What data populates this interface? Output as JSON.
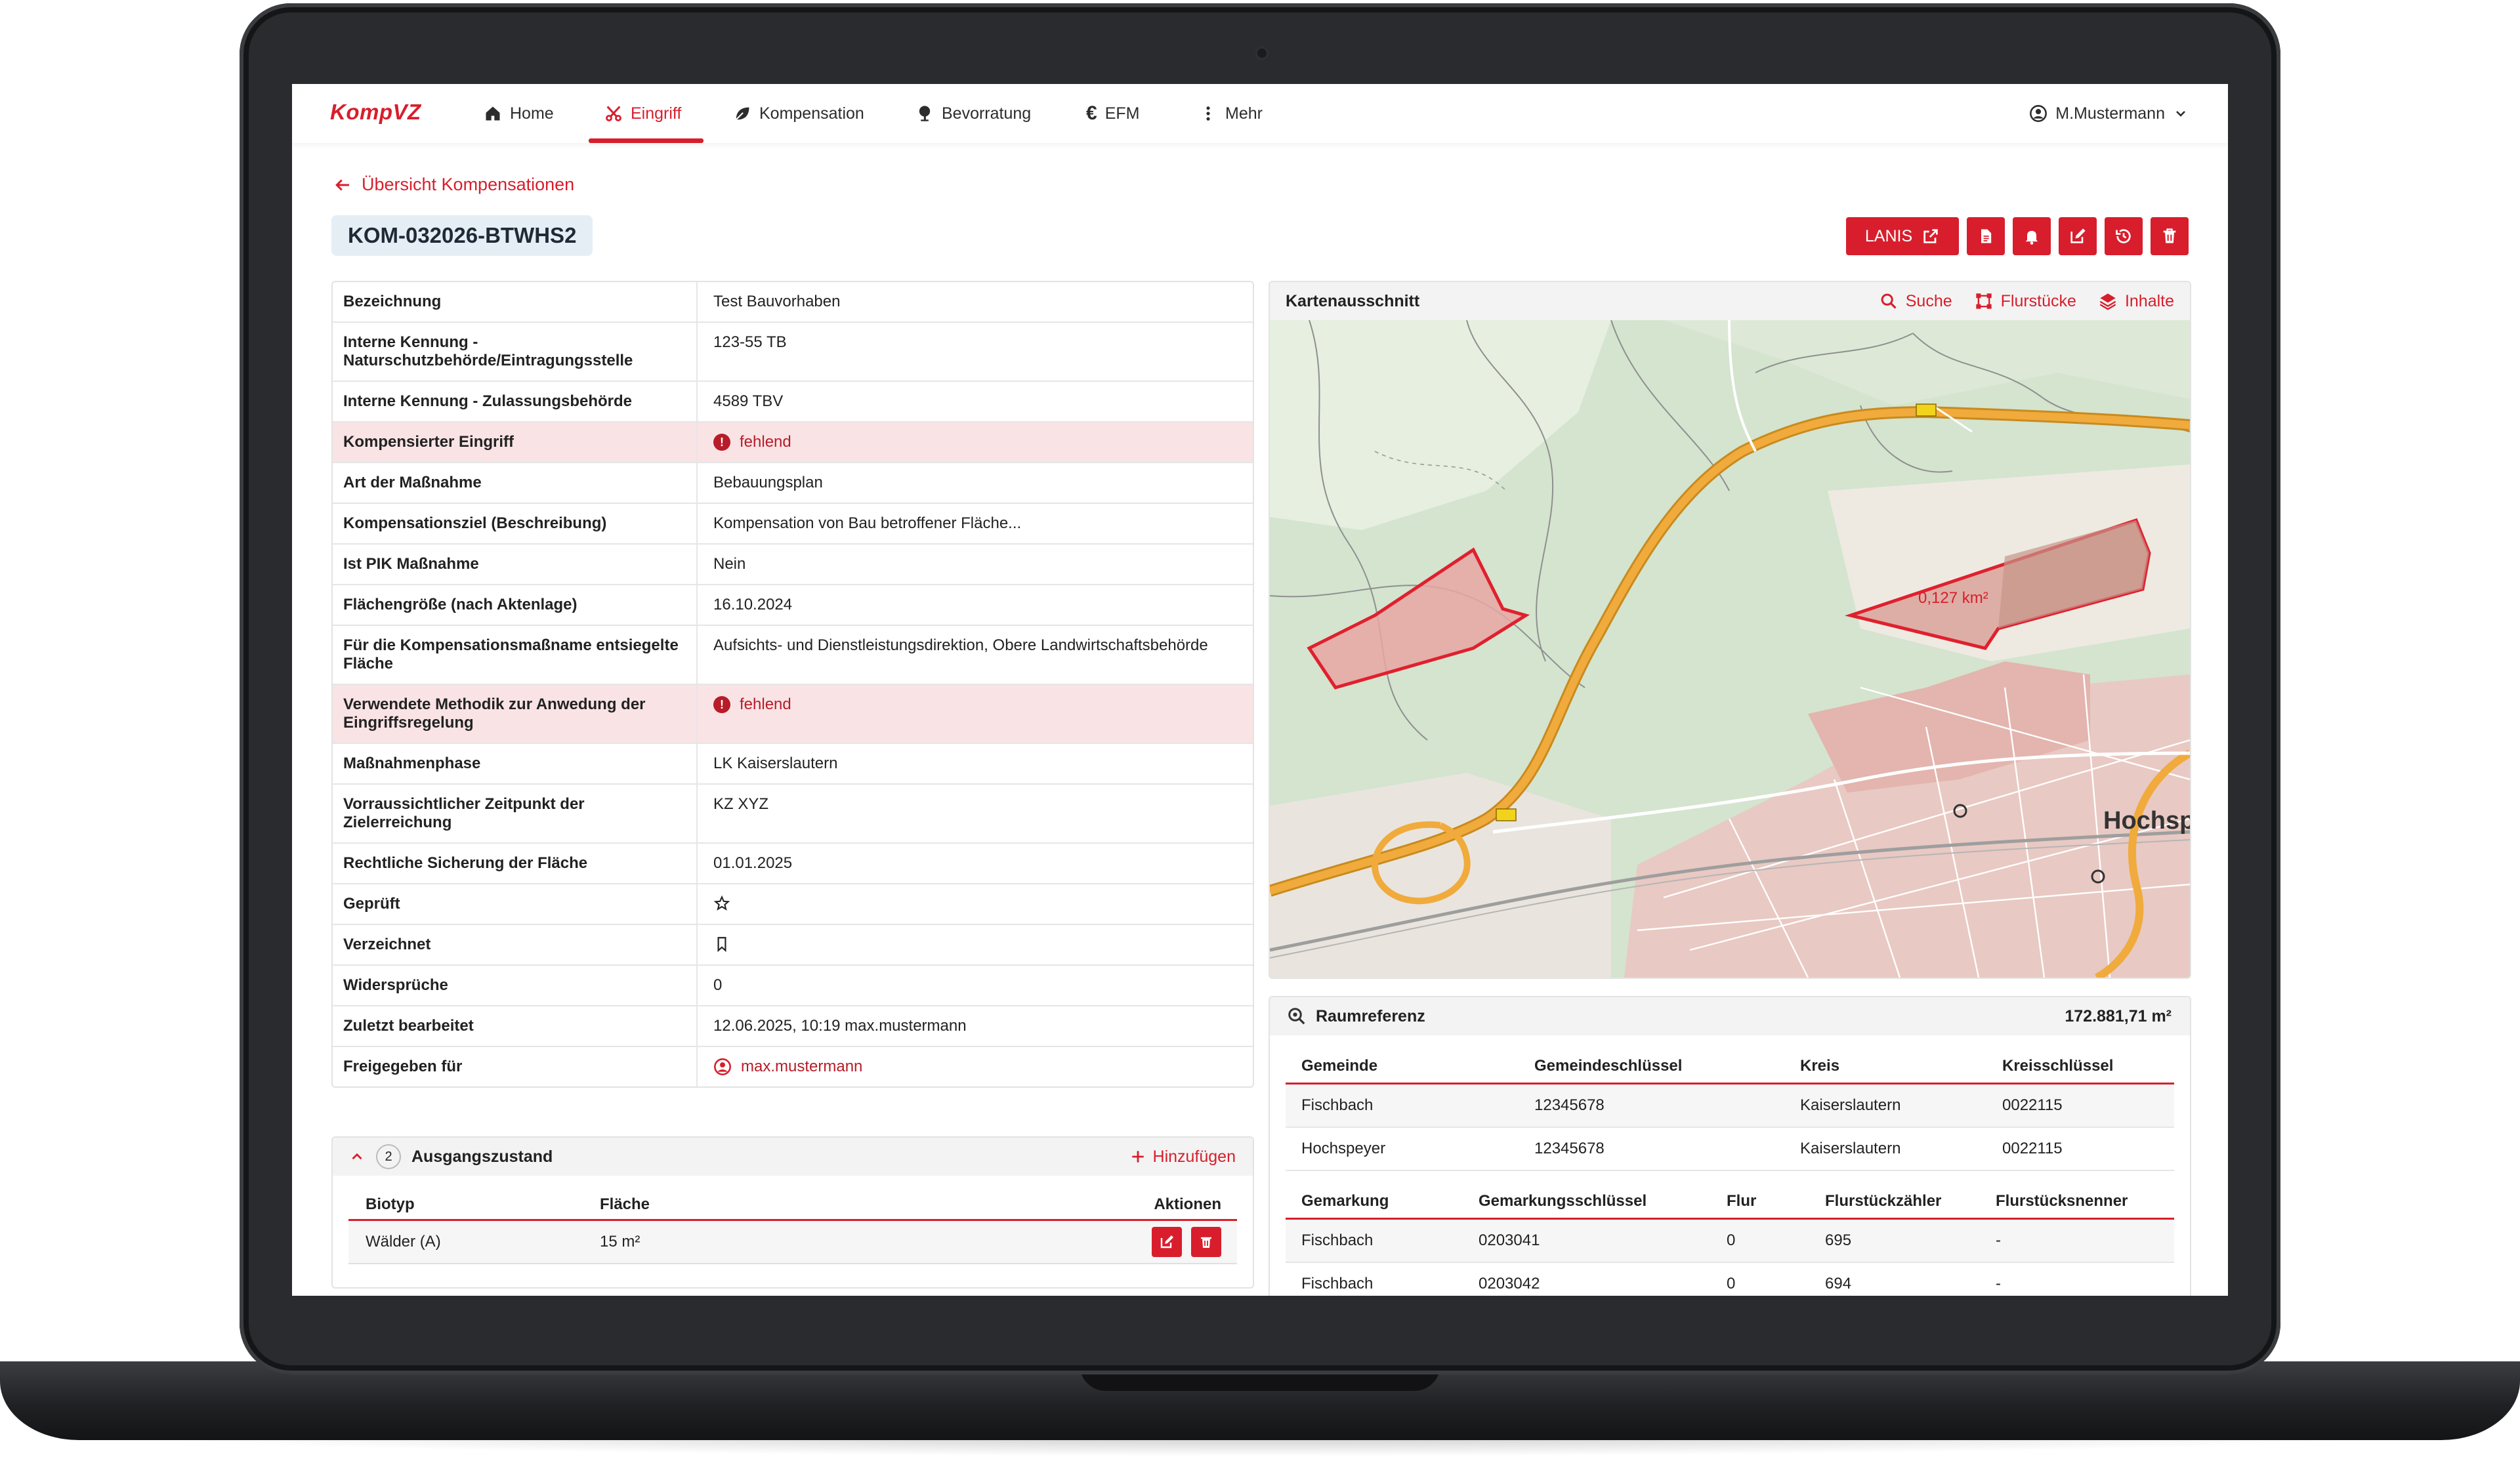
{
  "app": {
    "logo": "KompVZ",
    "user": "M.Mustermann"
  },
  "nav": [
    {
      "label": "Home",
      "icon": "home-icon"
    },
    {
      "label": "Eingriff",
      "icon": "scissors-icon",
      "active": true
    },
    {
      "label": "Kompensation",
      "icon": "leaf-icon"
    },
    {
      "label": "Bevorratung",
      "icon": "tree-icon"
    },
    {
      "label": "EFM",
      "icon": "euro-icon"
    },
    {
      "label": "Mehr",
      "icon": "more-vertical-icon"
    }
  ],
  "breadcrumb": {
    "back_label": "Übersicht Kompensationen"
  },
  "record": {
    "id": "KOM-032026-BTWHS2"
  },
  "toolbar": {
    "lanis_label": "LANIS"
  },
  "details": [
    {
      "label": "Bezeichnung",
      "value": "Test Bauvorhaben"
    },
    {
      "label": "Interne Kennung - Naturschutzbehörde/Eintragungsstelle",
      "value": "123-55 TB"
    },
    {
      "label": "Interne Kennung - Zulassungsbehörde",
      "value": "4589 TBV"
    },
    {
      "label": "Kompensierter Eingriff",
      "value": "fehlend",
      "status": "error"
    },
    {
      "label": "Art der Maßnahme",
      "value": "Bebauungsplan"
    },
    {
      "label": "Kompensationsziel (Beschreibung)",
      "value": "Kompensation von Bau betroffener Fläche..."
    },
    {
      "label": "Ist PIK Maßnahme",
      "value": "Nein"
    },
    {
      "label": "Flächengröße (nach Aktenlage)",
      "value": "16.10.2024"
    },
    {
      "label": "Für die Kompensationsmaßname entsiegelte Fläche",
      "value": "Aufsichts- und Dienstleistungsdirektion, Obere Landwirtschaftsbehörde"
    },
    {
      "label": "Verwendete Methodik zur Anwedung der Eingriffsregelung",
      "value": "fehlend",
      "status": "error"
    },
    {
      "label": "Maßnahmenphase",
      "value": "LK Kaiserslautern"
    },
    {
      "label": "Vorraussichtlicher Zeitpunkt der Zielerreichung",
      "value": "KZ XYZ"
    },
    {
      "label": "Rechtliche Sicherung der Fläche",
      "value": "01.01.2025"
    },
    {
      "label": "Geprüft",
      "value": "",
      "icon": "star-outline-icon"
    },
    {
      "label": "Verzeichnet",
      "value": "",
      "icon": "bookmark-outline-icon"
    },
    {
      "label": "Widersprüche",
      "value": "0"
    },
    {
      "label": "Zuletzt bearbeitet",
      "value": "12.06.2025, 10:19 max.mustermann"
    },
    {
      "label": "Freigegeben für",
      "value": "max.mustermann",
      "icon": "user-circle-icon",
      "status": "link"
    }
  ],
  "ausgangszustand": {
    "count": "2",
    "title": "Ausgangszustand",
    "add_label": "Hinzufügen",
    "columns": [
      "Biotyp",
      "Fläche",
      "Aktionen"
    ],
    "rows": [
      {
        "biotyp": "Wälder (A)",
        "flaeche": "15 m²"
      }
    ]
  },
  "map": {
    "title": "Kartenausschnitt",
    "actions": [
      "Suche",
      "Flurstücke",
      "Inhalte"
    ],
    "area_label": "0,127 km²",
    "town_label": "Hochspe"
  },
  "raumreferenz": {
    "title": "Raumreferenz",
    "total": "172.881,71 m²",
    "gemeinde_columns": [
      "Gemeinde",
      "Gemeindeschlüssel",
      "Kreis",
      "Kreisschlüssel"
    ],
    "gemeinde_rows": [
      [
        "Fischbach",
        "12345678",
        "Kaiserslautern",
        "0022115"
      ],
      [
        "Hochspeyer",
        "12345678",
        "Kaiserslautern",
        "0022115"
      ]
    ],
    "gemarkung_columns": [
      "Gemarkung",
      "Gemarkungsschlüssel",
      "Flur",
      "Flurstückzähler",
      "Flurstücksnenner"
    ],
    "gemarkung_rows": [
      [
        "Fischbach",
        "0203041",
        "0",
        "695",
        "-"
      ],
      [
        "Fischbach",
        "0203042",
        "0",
        "694",
        "-"
      ]
    ]
  },
  "colors": {
    "accent": "#d81e2c",
    "error_bg": "#f9e3e5",
    "badge_bg": "#e6eef5"
  }
}
